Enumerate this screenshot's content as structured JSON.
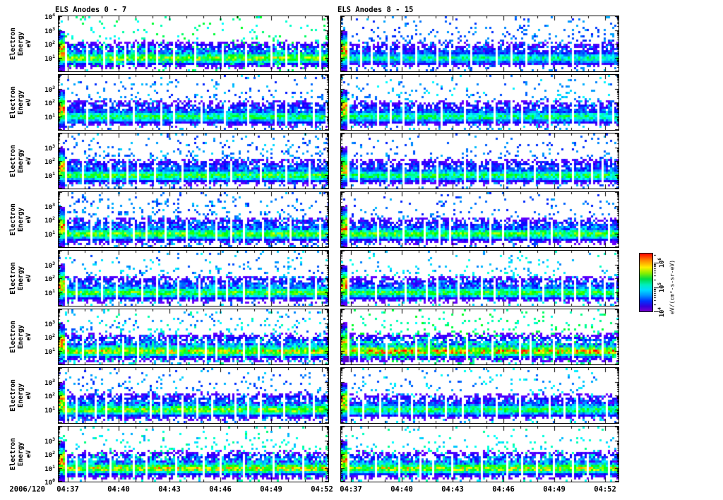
{
  "date_label": "2006/120",
  "columns": [
    {
      "title": "ELS Anodes 0 - 7"
    },
    {
      "title": "ELS Anodes 8 - 15"
    }
  ],
  "x_axis": {
    "tick_labels": [
      "04:37",
      "04:40",
      "04:43",
      "04:46",
      "04:49",
      "04:52"
    ]
  },
  "y_axis": {
    "title_line1": "Electron Energy",
    "title_line2": "eV",
    "top_panel_exponents": [
      4,
      3,
      2,
      1
    ],
    "middle_panel_exponents": [
      3,
      2,
      1
    ],
    "bottom_panel_exponents": [
      3,
      2,
      1,
      0
    ]
  },
  "colorbar": {
    "tick_exponents_top_to_bottom": [
      6,
      5,
      4
    ],
    "unit_label": "eV/(cm²-s-sr-eV)",
    "palette_top_to_bottom": [
      "#ff0000",
      "#ff8800",
      "#ffee00",
      "#00dd44",
      "#00ddff",
      "#0033ff",
      "#7700cc"
    ]
  },
  "chart_data": {
    "type": "heatmap",
    "subtype": "energy-time electron spectrogram grid",
    "grid": {
      "rows": 8,
      "cols": 2
    },
    "column_titles": [
      "ELS Anodes 0 - 7",
      "ELS Anodes 8 - 15"
    ],
    "date": "2006/120",
    "x": {
      "tick_labels": [
        "04:37",
        "04:40",
        "04:43",
        "04:46",
        "04:49",
        "04:52"
      ],
      "minor_tick_interval_minutes": 1,
      "approx_range": [
        "04:36.4",
        "04:52.4"
      ]
    },
    "y": {
      "label": "Electron Energy (eV)",
      "scale": "log",
      "range_eV": [
        1,
        10000
      ],
      "decade_ticks_eV": [
        1,
        10,
        100,
        1000,
        10000
      ]
    },
    "z": {
      "unit": "eV/(cm²-s-sr-eV)",
      "scale": "log",
      "colorbar_tick_exponents_top_to_bottom": [
        6,
        5,
        4
      ],
      "palette_order_high_to_low": [
        "red",
        "orange",
        "yellow",
        "green",
        "cyan",
        "blue",
        "violet"
      ]
    },
    "panels": [
      {
        "anode": 0,
        "col": 0,
        "row": 0,
        "band_center_eV": 9,
        "band_intensity": 0.78,
        "speckle_density": 0.1,
        "speckle_value_range": [
          0.33,
          0.55
        ],
        "left_edge_enhancement": true,
        "purple_blob": false
      },
      {
        "anode": 1,
        "col": 0,
        "row": 1,
        "band_center_eV": 9,
        "band_intensity": 0.62,
        "speckle_density": 0.14,
        "speckle_value_range": [
          0.16,
          0.33
        ],
        "left_edge_enhancement": true,
        "purple_blob": false
      },
      {
        "anode": 2,
        "col": 0,
        "row": 2,
        "band_center_eV": 9,
        "band_intensity": 0.68,
        "speckle_density": 0.17,
        "speckle_value_range": [
          0.16,
          0.33
        ],
        "left_edge_enhancement": true,
        "purple_blob": false
      },
      {
        "anode": 3,
        "col": 0,
        "row": 3,
        "band_center_eV": 9,
        "band_intensity": 0.72,
        "speckle_density": 0.19,
        "speckle_value_range": [
          0.16,
          0.33
        ],
        "left_edge_enhancement": true,
        "purple_blob": false
      },
      {
        "anode": 4,
        "col": 0,
        "row": 4,
        "band_center_eV": 9,
        "band_intensity": 0.7,
        "speckle_density": 0.13,
        "speckle_value_range": [
          0.18,
          0.38
        ],
        "left_edge_enhancement": true,
        "purple_blob": false
      },
      {
        "anode": 5,
        "col": 0,
        "row": 5,
        "band_center_eV": 9,
        "band_intensity": 0.88,
        "speckle_density": 0.15,
        "speckle_value_range": [
          0.2,
          0.45
        ],
        "left_edge_enhancement": true,
        "purple_blob": false
      },
      {
        "anode": 6,
        "col": 0,
        "row": 6,
        "band_center_eV": 9,
        "band_intensity": 0.78,
        "speckle_density": 0.14,
        "speckle_value_range": [
          0.16,
          0.33
        ],
        "left_edge_enhancement": true,
        "purple_blob": false
      },
      {
        "anode": 7,
        "col": 0,
        "row": 7,
        "band_center_eV": 9,
        "band_intensity": 0.86,
        "speckle_density": 0.12,
        "speckle_value_range": [
          0.28,
          0.48
        ],
        "left_edge_enhancement": true,
        "purple_blob": false
      },
      {
        "anode": 8,
        "col": 1,
        "row": 0,
        "band_center_eV": 9,
        "band_intensity": 0.52,
        "speckle_density": 0.16,
        "speckle_value_range": [
          0.16,
          0.3
        ],
        "left_edge_enhancement": true,
        "purple_blob": false
      },
      {
        "anode": 9,
        "col": 1,
        "row": 1,
        "band_center_eV": 9,
        "band_intensity": 0.58,
        "speckle_density": 0.12,
        "speckle_value_range": [
          0.18,
          0.36
        ],
        "left_edge_enhancement": true,
        "purple_blob": false
      },
      {
        "anode": 10,
        "col": 1,
        "row": 2,
        "band_center_eV": 9,
        "band_intensity": 0.62,
        "speckle_density": 0.11,
        "speckle_value_range": [
          0.16,
          0.3
        ],
        "left_edge_enhancement": true,
        "purple_blob": false
      },
      {
        "anode": 11,
        "col": 1,
        "row": 3,
        "band_center_eV": 9,
        "band_intensity": 0.7,
        "speckle_density": 0.11,
        "speckle_value_range": [
          0.16,
          0.3
        ],
        "left_edge_enhancement": true,
        "purple_blob": false
      },
      {
        "anode": 12,
        "col": 1,
        "row": 4,
        "band_center_eV": 9,
        "band_intensity": 0.66,
        "speckle_density": 0.11,
        "speckle_value_range": [
          0.25,
          0.42
        ],
        "left_edge_enhancement": true,
        "purple_blob": false
      },
      {
        "anode": 13,
        "col": 1,
        "row": 5,
        "band_center_eV": 9,
        "band_intensity": 1.0,
        "speckle_density": 0.13,
        "speckle_value_range": [
          0.35,
          0.55
        ],
        "left_edge_enhancement": true,
        "purple_blob": true
      },
      {
        "anode": 14,
        "col": 1,
        "row": 6,
        "band_center_eV": 9,
        "band_intensity": 0.62,
        "speckle_density": 0.09,
        "speckle_value_range": [
          0.2,
          0.38
        ],
        "left_edge_enhancement": true,
        "purple_blob": false
      },
      {
        "anode": 15,
        "col": 1,
        "row": 7,
        "band_center_eV": 9,
        "band_intensity": 0.84,
        "speckle_density": 0.1,
        "speckle_value_range": [
          0.28,
          0.45
        ],
        "left_edge_enhancement": true,
        "purple_blob": false
      }
    ]
  }
}
